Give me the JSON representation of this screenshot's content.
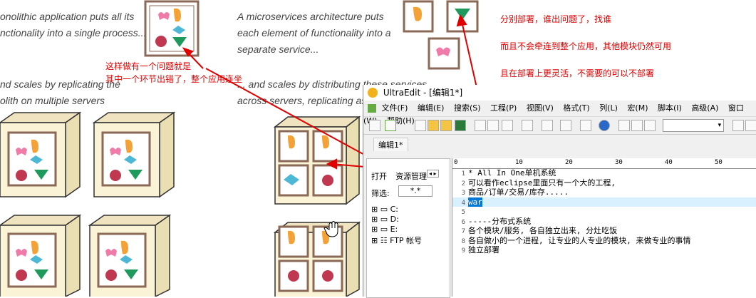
{
  "slide": {
    "mono_desc": "onolithic application puts all its\nnctionality into a single process...",
    "micro_desc": "A microservices architecture puts\neach element of functionality into a\nseparate service...",
    "mono_scale": "nd scales by replicating the\nolith on multiple servers",
    "micro_scale": "... and scales by distributing these services\nacross servers, replicating as"
  },
  "annotations": {
    "note_left_1": "这样做有一个问题就是",
    "note_left_2": "其中一个环节出错了，整个应用连坐",
    "note_right_1": "分别部署，谁出问题了，找谁",
    "note_right_2": "而且不会牵连到整个应用，其他模块仍然可用",
    "note_right_3": "且在部署上更灵活，不需要的可以不部署"
  },
  "colors": {
    "annotation_red": "#e00000",
    "box_face": "#fbf3d6",
    "box_side": "#eadfb3",
    "frame_border": "#8a6a57",
    "selection": "#0078d7",
    "current_line": "#d9f1ff"
  },
  "ultraedit": {
    "title": "UltraEdit - [编辑1*]",
    "menu": [
      "文件(F)",
      "编辑(E)",
      "搜索(S)",
      "工程(P)",
      "视图(V)",
      "格式(T)",
      "列(L)",
      "宏(M)",
      "脚本(I)",
      "高级(A)",
      "窗口(W)",
      "帮助(H)"
    ],
    "tab": "编辑1*",
    "panel_tabs": [
      "打开",
      "资源管理"
    ],
    "filter_label": "筛选:",
    "filter_value": "*.*",
    "drives": [
      "C:",
      "D:",
      "E:",
      "FTP 帐号"
    ],
    "ruler": [
      "0",
      "10",
      "20",
      "30",
      "40",
      "50"
    ],
    "lines": [
      "* All In One单机系统",
      "可以看作eclipse里面只有一个大的工程,",
      "商品/订单/交易/库存.....",
      "war",
      "",
      "-----分布式系统",
      "各个模块/服务, 各自独立出来, 分灶吃饭",
      "各自做小的一个进程, 让专业的人专业的模块, 来做专业的事情",
      "独立部署"
    ],
    "line_numbers": [
      "1",
      "2",
      "3",
      "4",
      "5",
      "6",
      "7",
      "8",
      "9"
    ]
  }
}
